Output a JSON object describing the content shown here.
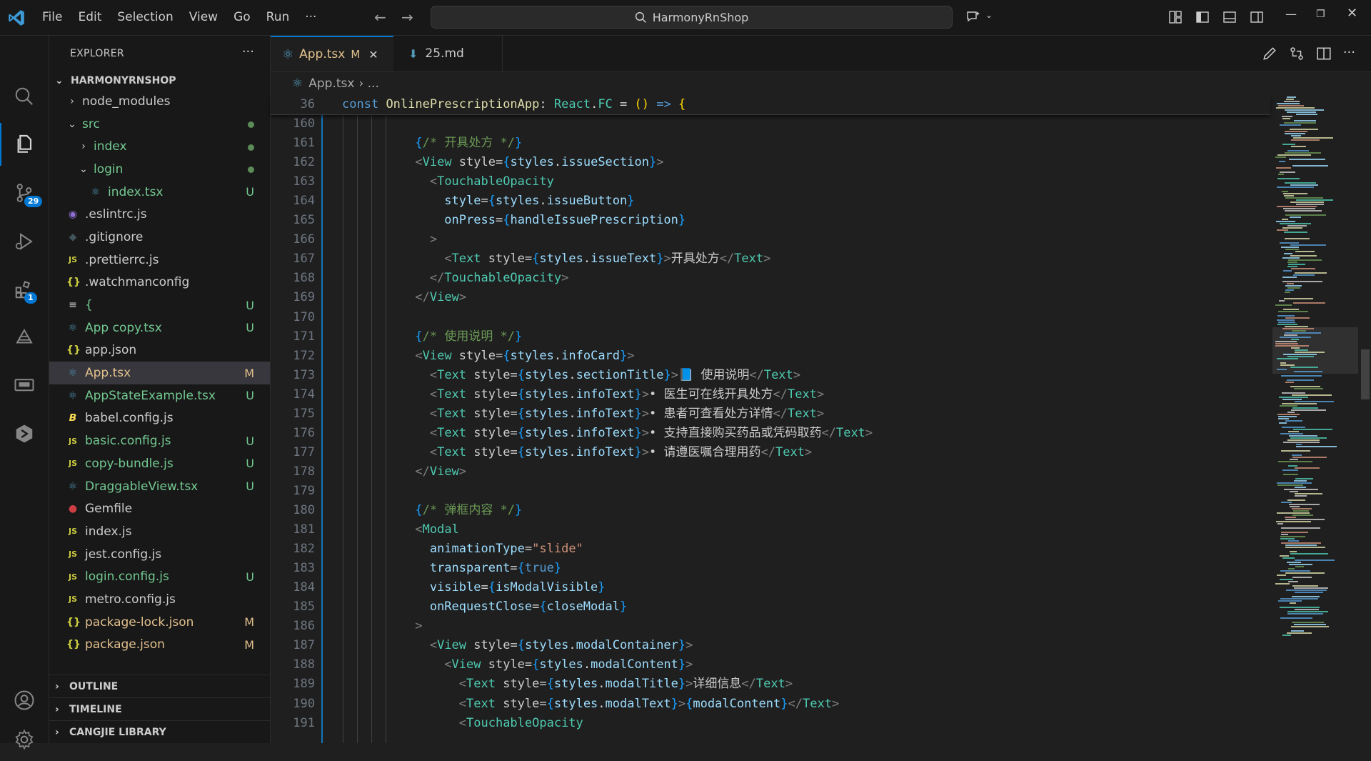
{
  "titlebar": {
    "menu": [
      "File",
      "Edit",
      "Selection",
      "View",
      "Go",
      "Run",
      "···"
    ],
    "search": "HarmonyRnShop"
  },
  "activitybar": {
    "source_control_badge": "29",
    "extensions_badge": "1"
  },
  "sidebar": {
    "title": "EXPLORER",
    "more": "···",
    "root": "HARMONYRNSHOP",
    "items": [
      {
        "name": "node_modules",
        "indent": 1,
        "chevron": "›",
        "icon": "",
        "status": "",
        "kind": "plain"
      },
      {
        "name": "src",
        "indent": 1,
        "chevron": "⌄",
        "icon": "",
        "status": "dot",
        "kind": "green"
      },
      {
        "name": "index",
        "indent": 2,
        "chevron": "›",
        "icon": "",
        "status": "dot",
        "kind": "green"
      },
      {
        "name": "login",
        "indent": 2,
        "chevron": "⌄",
        "icon": "",
        "status": "dot",
        "kind": "green"
      },
      {
        "name": "index.tsx",
        "indent": 3,
        "chevron": "",
        "icon": "react",
        "status": "U",
        "kind": "green"
      },
      {
        "name": ".eslintrc.js",
        "indent": 1,
        "chevron": "",
        "icon": "eslint",
        "status": "",
        "kind": "plain"
      },
      {
        "name": ".gitignore",
        "indent": 1,
        "chevron": "",
        "icon": "git",
        "status": "",
        "kind": "plain"
      },
      {
        "name": ".prettierrc.js",
        "indent": 1,
        "chevron": "",
        "icon": "js",
        "status": "",
        "kind": "plain"
      },
      {
        "name": ".watchmanconfig",
        "indent": 1,
        "chevron": "",
        "icon": "json",
        "status": "",
        "kind": "plain"
      },
      {
        "name": "{",
        "indent": 1,
        "chevron": "",
        "icon": "lines",
        "status": "U",
        "kind": "green"
      },
      {
        "name": "App copy.tsx",
        "indent": 1,
        "chevron": "",
        "icon": "react",
        "status": "U",
        "kind": "green"
      },
      {
        "name": "app.json",
        "indent": 1,
        "chevron": "",
        "icon": "json",
        "status": "",
        "kind": "plain"
      },
      {
        "name": "App.tsx",
        "indent": 1,
        "chevron": "",
        "icon": "react",
        "status": "M",
        "kind": "modified",
        "selected": true
      },
      {
        "name": "AppStateExample.tsx",
        "indent": 1,
        "chevron": "",
        "icon": "react",
        "status": "U",
        "kind": "green"
      },
      {
        "name": "babel.config.js",
        "indent": 1,
        "chevron": "",
        "icon": "babel",
        "status": "",
        "kind": "plain"
      },
      {
        "name": "basic.config.js",
        "indent": 1,
        "chevron": "",
        "icon": "js",
        "status": "U",
        "kind": "green"
      },
      {
        "name": "copy-bundle.js",
        "indent": 1,
        "chevron": "",
        "icon": "js",
        "status": "U",
        "kind": "green"
      },
      {
        "name": "DraggableView.tsx",
        "indent": 1,
        "chevron": "",
        "icon": "react",
        "status": "U",
        "kind": "green"
      },
      {
        "name": "Gemfile",
        "indent": 1,
        "chevron": "",
        "icon": "ruby",
        "status": "",
        "kind": "plain"
      },
      {
        "name": "index.js",
        "indent": 1,
        "chevron": "",
        "icon": "js",
        "status": "",
        "kind": "plain"
      },
      {
        "name": "jest.config.js",
        "indent": 1,
        "chevron": "",
        "icon": "js",
        "status": "",
        "kind": "plain"
      },
      {
        "name": "login.config.js",
        "indent": 1,
        "chevron": "",
        "icon": "js",
        "status": "U",
        "kind": "green"
      },
      {
        "name": "metro.config.js",
        "indent": 1,
        "chevron": "",
        "icon": "js",
        "status": "",
        "kind": "plain"
      },
      {
        "name": "package-lock.json",
        "indent": 1,
        "chevron": "",
        "icon": "json",
        "status": "M",
        "kind": "modified"
      },
      {
        "name": "package.json",
        "indent": 1,
        "chevron": "",
        "icon": "json",
        "status": "M",
        "kind": "modified"
      }
    ],
    "sections": [
      "OUTLINE",
      "TIMELINE",
      "CANGJIE LIBRARY"
    ]
  },
  "tabs": [
    {
      "label": "App.tsx",
      "status": "M",
      "active": true
    },
    {
      "label": "25.md",
      "status": "",
      "active": false
    }
  ],
  "breadcrumb": {
    "file": "App.tsx",
    "rest": "›  ..."
  },
  "sticky": {
    "line": "36",
    "code": "const OnlinePrescriptionApp: React.FC = () => {"
  },
  "code_lines": [
    {
      "n": "160",
      "t": ""
    },
    {
      "n": "161",
      "t": "{/* 开具处方 */}"
    },
    {
      "n": "162",
      "t": "<View style={styles.issueSection}>"
    },
    {
      "n": "163",
      "t": "  <TouchableOpacity"
    },
    {
      "n": "164",
      "t": "    style={styles.issueButton}"
    },
    {
      "n": "165",
      "t": "    onPress={handleIssuePrescription}"
    },
    {
      "n": "166",
      "t": "  >"
    },
    {
      "n": "167",
      "t": "    <Text style={styles.issueText}>开具处方</Text>"
    },
    {
      "n": "168",
      "t": "  </TouchableOpacity>"
    },
    {
      "n": "169",
      "t": "</View>"
    },
    {
      "n": "170",
      "t": ""
    },
    {
      "n": "171",
      "t": "{/* 使用说明 */}"
    },
    {
      "n": "172",
      "t": "<View style={styles.infoCard}>"
    },
    {
      "n": "173",
      "t": "  <Text style={styles.sectionTitle}>📘 使用说明</Text>"
    },
    {
      "n": "174",
      "t": "  <Text style={styles.infoText}>• 医生可在线开具处方</Text>"
    },
    {
      "n": "175",
      "t": "  <Text style={styles.infoText}>• 患者可查看处方详情</Text>"
    },
    {
      "n": "176",
      "t": "  <Text style={styles.infoText}>• 支持直接购买药品或凭码取药</Text>"
    },
    {
      "n": "177",
      "t": "  <Text style={styles.infoText}>• 请遵医嘱合理用药</Text>"
    },
    {
      "n": "178",
      "t": "</View>"
    },
    {
      "n": "179",
      "t": ""
    },
    {
      "n": "180",
      "t": "{/* 弹框内容 */}"
    },
    {
      "n": "181",
      "t": "<Modal"
    },
    {
      "n": "182",
      "t": "  animationType=\"slide\""
    },
    {
      "n": "183",
      "t": "  transparent={true}"
    },
    {
      "n": "184",
      "t": "  visible={isModalVisible}"
    },
    {
      "n": "185",
      "t": "  onRequestClose={closeModal}"
    },
    {
      "n": "186",
      "t": ">"
    },
    {
      "n": "187",
      "t": "  <View style={styles.modalContainer}>"
    },
    {
      "n": "188",
      "t": "    <View style={styles.modalContent}>"
    },
    {
      "n": "189",
      "t": "      <Text style={styles.modalTitle}>详细信息</Text>"
    },
    {
      "n": "190",
      "t": "      <Text style={styles.modalText}>{modalContent}</Text>"
    },
    {
      "n": "191",
      "t": "      <TouchableOpacity"
    }
  ],
  "colors": {
    "accent": "#0078d4",
    "untracked": "#73c991",
    "modified": "#e2c08d"
  }
}
